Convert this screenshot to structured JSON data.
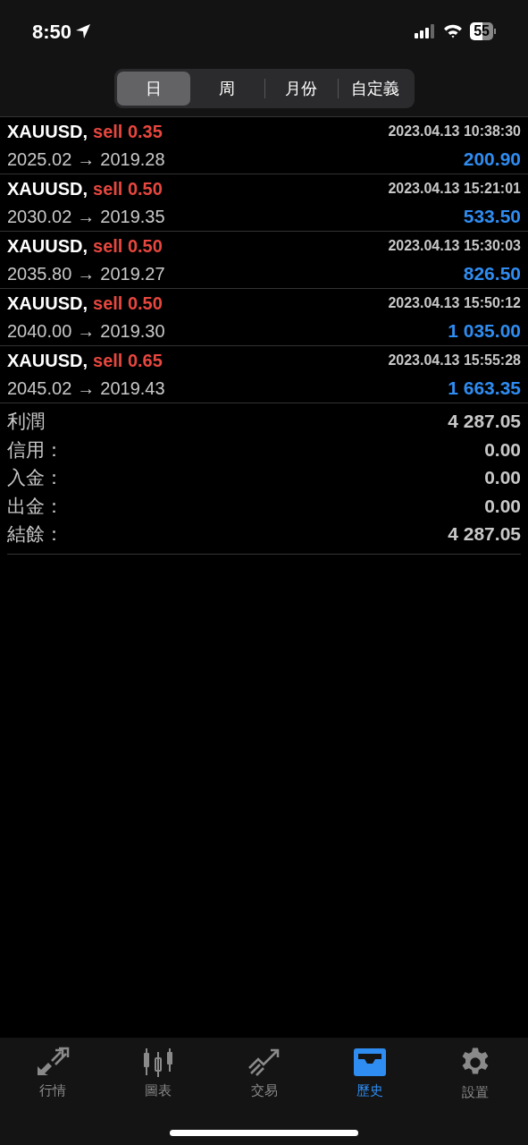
{
  "status_bar": {
    "time": "8:50",
    "battery": "55"
  },
  "period_tabs": [
    {
      "label": "日",
      "selected": true
    },
    {
      "label": "周",
      "selected": false
    },
    {
      "label": "月份",
      "selected": false
    },
    {
      "label": "自定義",
      "selected": false
    }
  ],
  "deals": [
    {
      "symbol": "XAUUSD,",
      "side": "sell",
      "volume": "0.35",
      "time": "2023.04.13 10:38:30",
      "open_price": "2025.02",
      "arrow": "→",
      "close_price": "2019.28",
      "profit": "200.90"
    },
    {
      "symbol": "XAUUSD,",
      "side": "sell",
      "volume": "0.50",
      "time": "2023.04.13 15:21:01",
      "open_price": "2030.02",
      "arrow": "→",
      "close_price": "2019.35",
      "profit": "533.50"
    },
    {
      "symbol": "XAUUSD,",
      "side": "sell",
      "volume": "0.50",
      "time": "2023.04.13 15:30:03",
      "open_price": "2035.80",
      "arrow": "→",
      "close_price": "2019.27",
      "profit": "826.50"
    },
    {
      "symbol": "XAUUSD,",
      "side": "sell",
      "volume": "0.50",
      "time": "2023.04.13 15:50:12",
      "open_price": "2040.00",
      "arrow": "→",
      "close_price": "2019.30",
      "profit": "1 035.00"
    },
    {
      "symbol": "XAUUSD,",
      "side": "sell",
      "volume": "0.65",
      "time": "2023.04.13 15:55:28",
      "open_price": "2045.02",
      "arrow": "→",
      "close_price": "2019.43",
      "profit": "1 663.35"
    }
  ],
  "summary": [
    {
      "label": "利潤",
      "value": "4 287.05"
    },
    {
      "label": "信用：",
      "value": "0.00"
    },
    {
      "label": "入金：",
      "value": "0.00"
    },
    {
      "label": "出金：",
      "value": "0.00"
    },
    {
      "label": "結餘：",
      "value": "4 287.05"
    }
  ],
  "tab_bar": [
    {
      "kind": "quotes",
      "label": "行情",
      "selected": false
    },
    {
      "kind": "chart",
      "label": "圖表",
      "selected": false
    },
    {
      "kind": "trade",
      "label": "交易",
      "selected": false
    },
    {
      "kind": "history",
      "label": "歷史",
      "selected": true
    },
    {
      "kind": "settings",
      "label": "設置",
      "selected": false
    }
  ]
}
